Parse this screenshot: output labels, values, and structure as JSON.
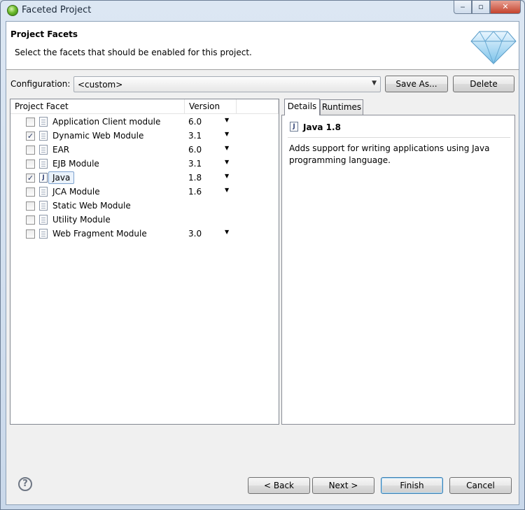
{
  "window": {
    "title": "Faceted Project",
    "minimize_glyph": "‒",
    "restore_glyph": "▫",
    "close_glyph": "✕"
  },
  "header": {
    "title": "Project Facets",
    "description": "Select the facets that should be enabled for this project."
  },
  "configuration": {
    "label": "Configuration:",
    "value": "<custom>",
    "save_as_label": "Save As...",
    "delete_label": "Delete"
  },
  "facets_table": {
    "col_facet": "Project Facet",
    "col_version": "Version",
    "rows": [
      {
        "name": "Application Client module",
        "version": "6.0",
        "checked": false,
        "has_dropdown": true
      },
      {
        "name": "Dynamic Web Module",
        "version": "3.1",
        "checked": true,
        "has_dropdown": true
      },
      {
        "name": "EAR",
        "version": "6.0",
        "checked": false,
        "has_dropdown": true
      },
      {
        "name": "EJB Module",
        "version": "3.1",
        "checked": false,
        "has_dropdown": true
      },
      {
        "name": "Java",
        "version": "1.8",
        "checked": true,
        "has_dropdown": true,
        "selected": true
      },
      {
        "name": "JCA Module",
        "version": "1.6",
        "checked": false,
        "has_dropdown": true
      },
      {
        "name": "Static Web Module",
        "version": "",
        "checked": false,
        "has_dropdown": false
      },
      {
        "name": "Utility Module",
        "version": "",
        "checked": false,
        "has_dropdown": false
      },
      {
        "name": "Web Fragment Module",
        "version": "3.0",
        "checked": false,
        "has_dropdown": true
      }
    ]
  },
  "details_panel": {
    "tabs": [
      "Details",
      "Runtimes"
    ],
    "active_tab": "Details",
    "title": "Java 1.8",
    "description": "Adds support for writing applications using Java programming language."
  },
  "footer": {
    "help_glyph": "?",
    "back_label": "< Back",
    "next_label": "Next >",
    "finish_label": "Finish",
    "cancel_label": "Cancel"
  },
  "icons": {
    "app": "eclipse-sphere-icon",
    "facet": "document-icon",
    "java": "java-file-icon",
    "banner": "diamond-icon",
    "help": "help-icon"
  }
}
